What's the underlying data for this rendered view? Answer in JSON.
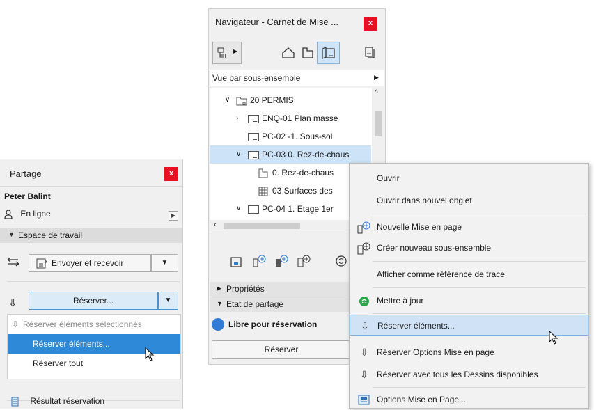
{
  "partage": {
    "title": "Partage",
    "close": "x",
    "user": "Peter Balint",
    "status": "En ligne",
    "workspace": "Espace de travail",
    "send_receive": "Envoyer et recevoir",
    "reserve": "Réserver...",
    "menu": [
      "Réserver éléments sélectionnés",
      "Réserver éléments...",
      "Réserver tout"
    ],
    "result": "Résultat réservation"
  },
  "nav": {
    "title": "Navigateur - Carnet de Mise ...",
    "close": "x",
    "view": "Vue par sous-ensemble",
    "tree": [
      "20 PERMIS",
      "ENQ-01 Plan masse",
      "PC-02 -1. Sous-sol",
      "PC-03 0. Rez-de-chaus",
      "0. Rez-de-chaus",
      "03 Surfaces des",
      "PC-04 1. Etage 1er"
    ],
    "properties": "Propriétés",
    "share_state": "Etat de partage",
    "free": "Libre pour réservation",
    "reserve_btn": "Réserver"
  },
  "context_menu": {
    "items": [
      "Ouvrir",
      "Ouvrir dans nouvel onglet",
      "Nouvelle Mise en page",
      "Créer nouveau sous-ensemble",
      "Afficher comme référence de trace",
      "Mettre à jour",
      "Réserver éléments...",
      "Réserver Options Mise en page",
      "Réserver avec tous les Dessins disponibles",
      "Options Mise en Page..."
    ]
  },
  "colors": {
    "accent": "#2f89d9",
    "close": "#e81123",
    "selected_row": "#cde3f7",
    "free_dot": "#2f7bd6"
  }
}
